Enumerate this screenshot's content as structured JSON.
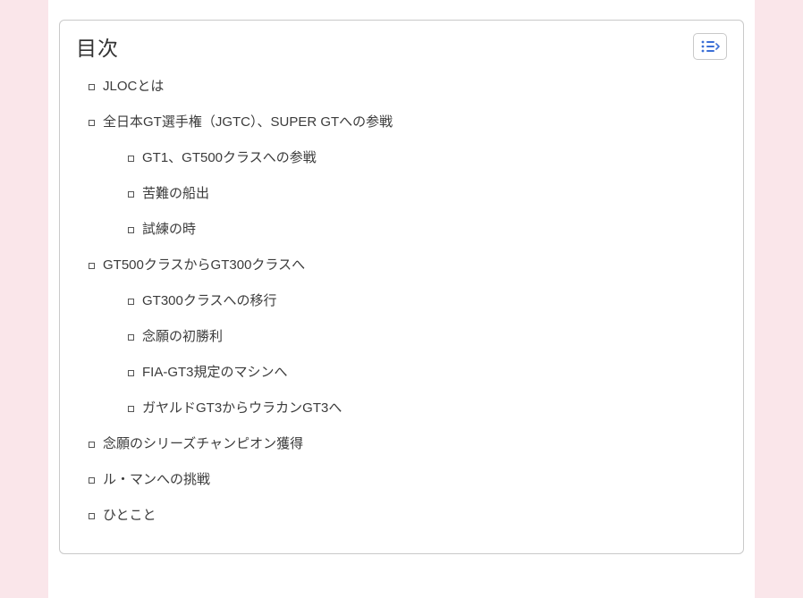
{
  "toc": {
    "title": "目次",
    "items": [
      {
        "label": "JLOCとは",
        "children": []
      },
      {
        "label": "全日本GT選手権（JGTC）、SUPER GTへの参戦",
        "children": [
          {
            "label": "GT1、GT500クラスへの参戦"
          },
          {
            "label": "苦難の船出"
          },
          {
            "label": "試練の時"
          }
        ]
      },
      {
        "label": "GT500クラスからGT300クラスへ",
        "children": [
          {
            "label": "GT300クラスへの移行"
          },
          {
            "label": "念願の初勝利"
          },
          {
            "label": "FIA-GT3規定のマシンへ"
          },
          {
            "label": "ガヤルドGT3からウラカンGT3へ"
          }
        ]
      },
      {
        "label": "念願のシリーズチャンピオン獲得",
        "children": []
      },
      {
        "label": "ル・マンへの挑戦",
        "children": []
      },
      {
        "label": "ひとこと",
        "children": []
      }
    ]
  },
  "colors": {
    "accent": "#3b6fd6"
  }
}
